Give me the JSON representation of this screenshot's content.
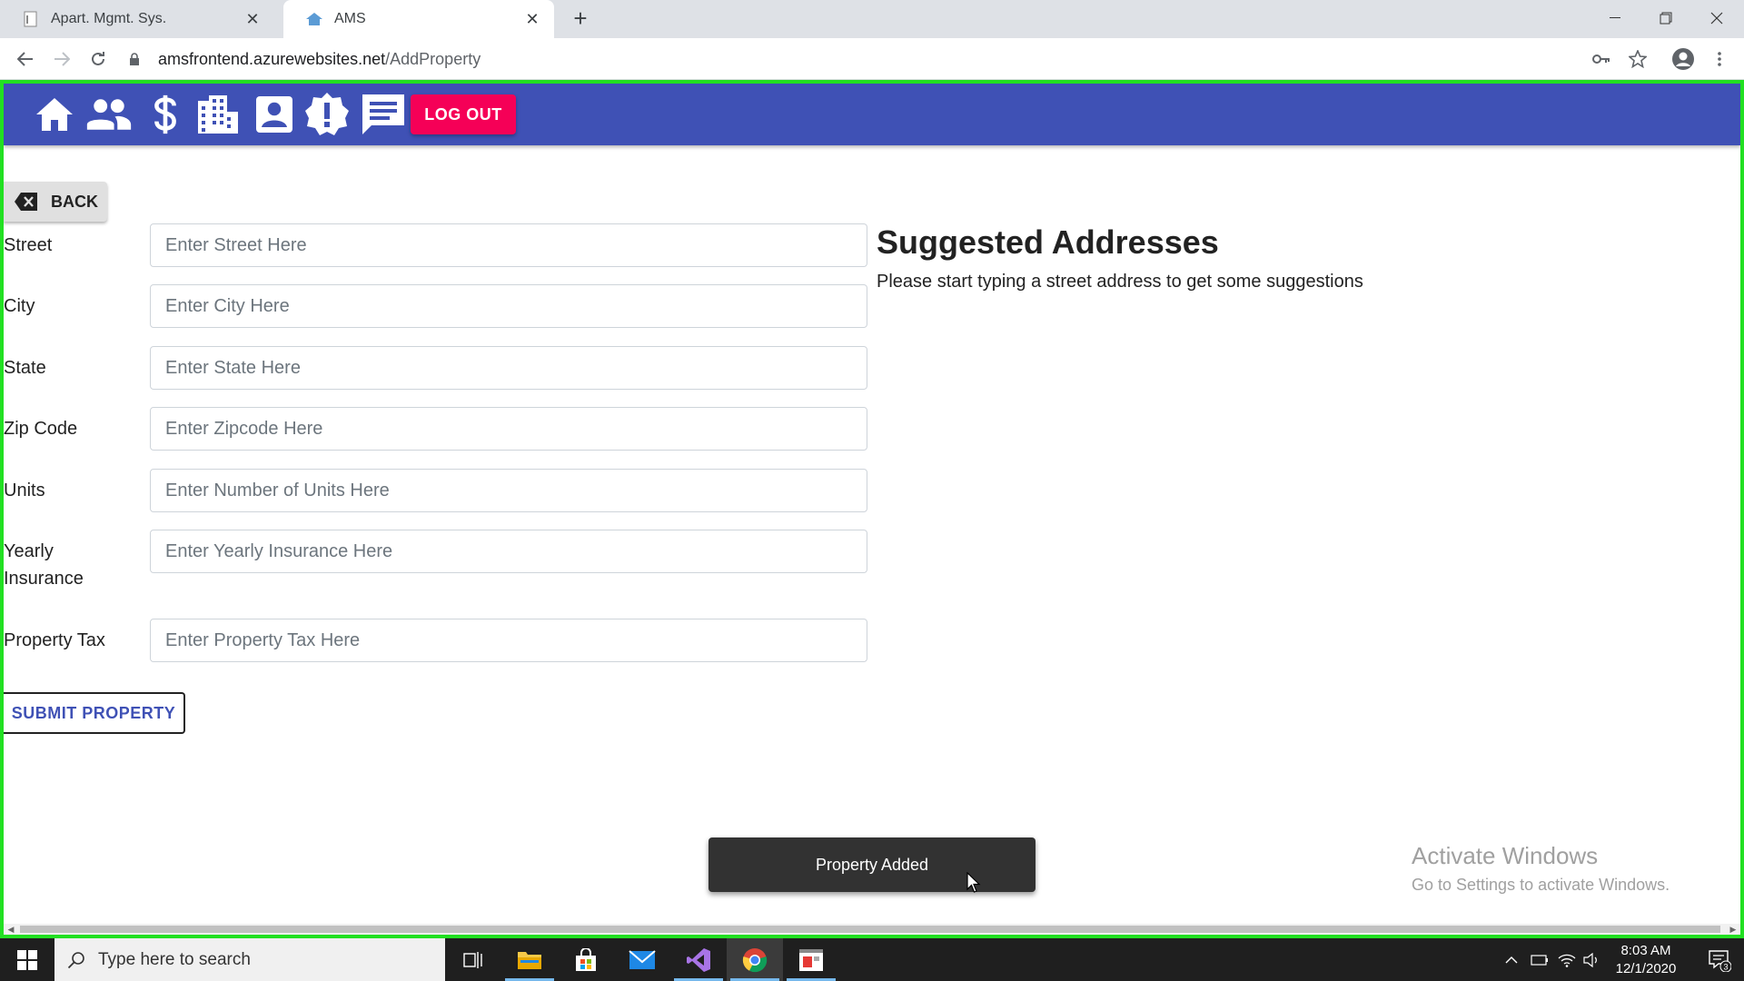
{
  "browser": {
    "tabs": [
      {
        "title": "Apart. Mgmt. Sys.",
        "active": false
      },
      {
        "title": "AMS",
        "active": true
      }
    ],
    "url_host": "amsfrontend.azurewebsites.net",
    "url_path": "/AddProperty"
  },
  "appbar": {
    "nav_icons": [
      "home-icon",
      "people-icon",
      "dollar-icon",
      "building-icon",
      "account-box-icon",
      "alert-icon",
      "message-icon"
    ],
    "logout_label": "LOG OUT",
    "color": "#3f51b5",
    "logout_color": "#f50057"
  },
  "back_label": "BACK",
  "form": {
    "street": {
      "label": "Street",
      "placeholder": "Enter Street Here",
      "value": ""
    },
    "city": {
      "label": "City",
      "placeholder": "Enter City Here",
      "value": ""
    },
    "state": {
      "label": "State",
      "placeholder": "Enter State Here",
      "value": ""
    },
    "zip": {
      "label": "Zip Code",
      "placeholder": "Enter Zipcode Here",
      "value": ""
    },
    "units": {
      "label": "Units",
      "placeholder": "Enter Number of Units Here",
      "value": ""
    },
    "insurance": {
      "label": "Yearly Insurance",
      "placeholder": "Enter Yearly Insurance Here",
      "value": ""
    },
    "tax": {
      "label": "Property Tax",
      "placeholder": "Enter Property Tax Here",
      "value": ""
    },
    "submit_label": "SUBMIT PROPERTY"
  },
  "suggestions": {
    "title": "Suggested Addresses",
    "hint": "Please start typing a street address to get some suggestions"
  },
  "toast": "Property Added",
  "watermark": {
    "line1": "Activate Windows",
    "line2": "Go to Settings to activate Windows."
  },
  "taskbar": {
    "search_placeholder": "Type here to search",
    "time": "8:03 AM",
    "date": "12/1/2020",
    "notification_count": "3"
  }
}
